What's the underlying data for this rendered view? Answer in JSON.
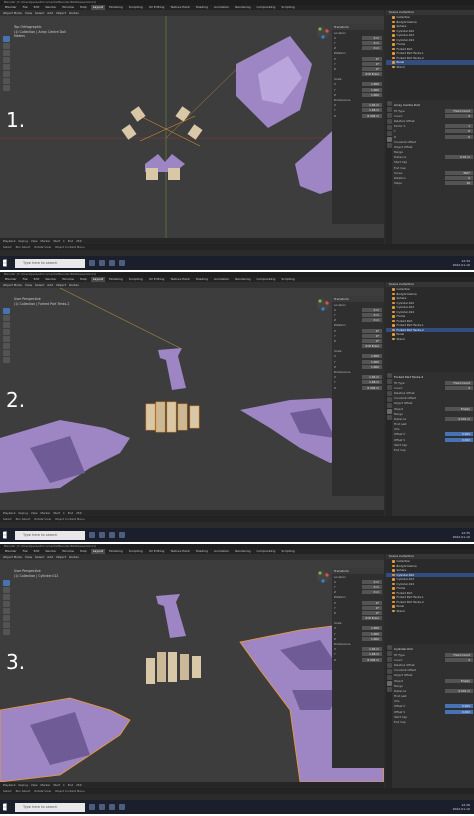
{
  "colors": {
    "mesh": "#9e86c4",
    "meshDark": "#6f5c96",
    "cube": "#d8c8a8",
    "select": "#f29a2e",
    "accent": "#4772b3"
  },
  "shared": {
    "menu": [
      "Blender",
      "File",
      "Edit",
      "Render",
      "Window",
      "Help",
      "Layout",
      "Modeling",
      "Sculpting",
      "UV Editing",
      "Texture Paint",
      "Shading",
      "Animation",
      "Rendering",
      "Compositing",
      "Scripting"
    ],
    "header": [
      "Object Mode",
      "View",
      "Select",
      "Add",
      "Object",
      "Global"
    ],
    "timeline": [
      "Playback",
      "Keying",
      "View",
      "Marker",
      "Start",
      "1",
      "End",
      "250"
    ],
    "taskbar": {
      "search": "Type here to search"
    },
    "outliner": {
      "title": "Scene Collection",
      "items": [
        "Collection",
        "BodyArmature",
        "Sphere",
        "Cylinder.012",
        "Cylinder.013",
        "Cylinder.014",
        "Frame",
        "Forked Part",
        "Forked Part Tenks.1",
        "Forked Part Tenks.2",
        "Panel",
        "Stand"
      ]
    },
    "npanel": {
      "title": "Transform",
      "rows": [
        [
          "Location",
          ""
        ],
        [
          "X",
          "0 m"
        ],
        [
          "Y",
          "0 m"
        ],
        [
          "Z",
          "0 m"
        ],
        [
          "Rotation",
          ""
        ],
        [
          "X",
          "0°"
        ],
        [
          "Y",
          "0°"
        ],
        [
          "Z",
          "0°"
        ],
        [
          "Mode",
          "XYZ Euler"
        ],
        [
          "Scale",
          ""
        ],
        [
          "X",
          "1.000"
        ],
        [
          "Y",
          "1.000"
        ],
        [
          "Z",
          "1.000"
        ],
        [
          "Dimensions",
          ""
        ],
        [
          "X",
          "1.62 m"
        ],
        [
          "Y",
          "1.66 m"
        ],
        [
          "Z",
          "0.392 m"
        ]
      ]
    }
  },
  "panels": [
    {
      "step": "1.",
      "title": "Blender [C:\\Users\\Jesse\\Documents\\Blender\\Battlesaw.blend]",
      "view": "Top Orthographic",
      "sub": "(1) Collection | Array Centre Doll",
      "third": "Meters",
      "props": {
        "title": "Array Centre Doll",
        "rows": [
          [
            "Fit Type",
            "Fixed Count"
          ],
          [
            "Count",
            "4"
          ],
          [
            "Relative Offset",
            ""
          ],
          [
            "Factor X",
            "1"
          ],
          [
            "Y",
            "0"
          ],
          [
            "Z",
            "0"
          ],
          [
            "Constant Offset",
            ""
          ],
          [
            "Object Offset",
            ""
          ],
          [
            "Merge",
            ""
          ],
          [
            "Distance",
            "0.01 m"
          ],
          [
            "Start Cap",
            ""
          ],
          [
            "End Cap",
            ""
          ],
          [
            "Screw",
            "360°"
          ],
          [
            "Rotation",
            "0"
          ],
          [
            "Steps",
            "16"
          ]
        ]
      },
      "status": [
        "Select",
        "Box Select",
        "Rotate View",
        "Object Context Menu"
      ],
      "clock": [
        "12:34",
        "2022-01-10"
      ]
    },
    {
      "step": "2.",
      "title": "Blender [C:\\Users\\Jesse\\Documents\\Blender\\Battlesaw.blend]",
      "view": "User Perspective",
      "sub": "(1) Collection | Forked Part Tenks.2",
      "third": "",
      "props": {
        "title": "Forked Part Tenks.2",
        "rows": [
          [
            "Fit Type",
            "Fixed Count"
          ],
          [
            "Count",
            "4"
          ],
          [
            "Relative Offset",
            ""
          ],
          [
            "Constant Offset",
            ""
          ],
          [
            "Object Offset",
            ""
          ],
          [
            "Object",
            "Empty"
          ],
          [
            "Merge",
            ""
          ],
          [
            "Distance",
            "0.001 m"
          ],
          [
            "First Last",
            ""
          ],
          [
            "UVs",
            ""
          ],
          [
            "Offset U",
            "0.000"
          ],
          [
            "Offset V",
            "0.000"
          ],
          [
            "Start Cap",
            ""
          ],
          [
            "End Cap",
            ""
          ]
        ]
      },
      "status": [
        "Select",
        "Box Select",
        "Rotate View",
        "Object Context Menu"
      ],
      "clock": [
        "12:35",
        "2022-01-10"
      ]
    },
    {
      "step": "3.",
      "title": "Blender [C:\\Users\\Jesse\\Documents\\Blender\\Battlesaw.blend]",
      "view": "User Perspective",
      "sub": "(1) Collection | Cylinder.012",
      "third": "",
      "props": {
        "title": "Cylinder.012",
        "rows": [
          [
            "Fit Type",
            "Fixed Count"
          ],
          [
            "Count",
            "4"
          ],
          [
            "Relative Offset",
            ""
          ],
          [
            "Constant Offset",
            ""
          ],
          [
            "Object Offset",
            ""
          ],
          [
            "Object",
            "Empty"
          ],
          [
            "Merge",
            ""
          ],
          [
            "Distance",
            "0.001 m"
          ],
          [
            "First Last",
            ""
          ],
          [
            "UVs",
            ""
          ],
          [
            "Offset U",
            "0.000"
          ],
          [
            "Offset V",
            "0.000"
          ],
          [
            "Start Cap",
            ""
          ],
          [
            "End Cap",
            ""
          ]
        ]
      },
      "status": [
        "Select",
        "Box Select",
        "Rotate View",
        "Object Context Menu"
      ],
      "clock": [
        "12:36",
        "2022-01-10"
      ]
    }
  ]
}
